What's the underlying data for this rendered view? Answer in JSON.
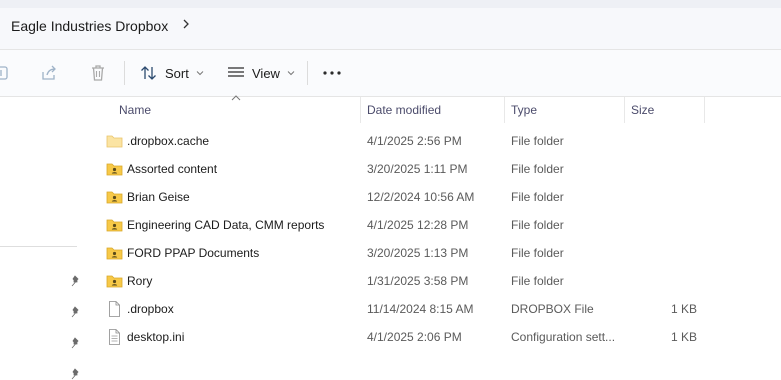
{
  "window": {
    "breadcrumb": "Eagle Industries Dropbox",
    "accent": "#0067c0"
  },
  "toolbar": {
    "sort_label": "Sort",
    "view_label": "View",
    "more_label": "..."
  },
  "columns": {
    "name": "Name",
    "date": "Date modified",
    "type": "Type",
    "size": "Size"
  },
  "files": [
    {
      "name": ".dropbox.cache",
      "date": "4/1/2025 2:56 PM",
      "type": "File folder",
      "size": "",
      "icon": "folder-icon"
    },
    {
      "name": "Assorted content",
      "date": "3/20/2025 1:11 PM",
      "type": "File folder",
      "size": "",
      "icon": "shared-folder-icon"
    },
    {
      "name": "Brian Geise",
      "date": "12/2/2024 10:56 AM",
      "type": "File folder",
      "size": "",
      "icon": "shared-folder-icon"
    },
    {
      "name": "Engineering CAD Data, CMM reports",
      "date": "4/1/2025 12:28 PM",
      "type": "File folder",
      "size": "",
      "icon": "shared-folder-icon"
    },
    {
      "name": "FORD PPAP Documents",
      "date": "3/20/2025 1:13 PM",
      "type": "File folder",
      "size": "",
      "icon": "shared-folder-icon"
    },
    {
      "name": "Rory",
      "date": "1/31/2025 3:58 PM",
      "type": "File folder",
      "size": "",
      "icon": "shared-folder-icon"
    },
    {
      "name": ".dropbox",
      "date": "11/14/2024 8:15 AM",
      "type": "DROPBOX File",
      "size": "1 KB",
      "icon": "file-icon"
    },
    {
      "name": "desktop.ini",
      "date": "4/1/2025 2:06 PM",
      "type": "Configuration sett...",
      "size": "1 KB",
      "icon": "settings-file-icon"
    }
  ]
}
